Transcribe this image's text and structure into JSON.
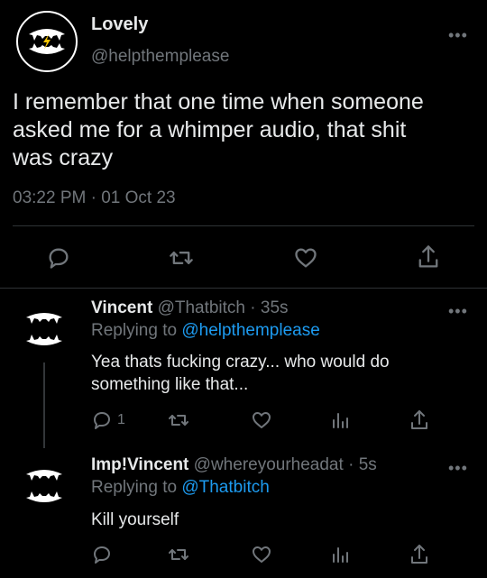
{
  "main_tweet": {
    "display_name": "Lovely",
    "handle": "@helpthemplease",
    "text_lines": [
      "I remember that one time when someone",
      "asked me for a whimper audio, that shit",
      "was crazy"
    ],
    "timestamp": "03:22 PM · 01 Oct 23"
  },
  "replies": [
    {
      "display_name": "Vincent",
      "handle": "@Thatbitch",
      "sep": "·",
      "time": "35s",
      "replying_prefix": "Replying to ",
      "replying_to": "@helpthemplease",
      "text_lines": [
        "Yea thats fucking crazy... who would do",
        "something like that..."
      ],
      "reply_count": "1"
    },
    {
      "display_name": "Imp!Vincent",
      "handle": "@whereyourheadat",
      "sep": "·",
      "time": "5s",
      "replying_prefix": "Replying to ",
      "replying_to": "@Thatbitch",
      "text_lines": [
        "Kill yourself"
      ],
      "reply_count": ""
    }
  ],
  "more_glyph": "•••",
  "colors": {
    "background": "#000000",
    "text": "#e7e9ea",
    "muted": "#71767b",
    "link": "#1d9bf0",
    "divider": "#2f3336"
  },
  "icons": [
    "reply-icon",
    "retweet-icon",
    "like-icon",
    "share-icon",
    "views-icon",
    "more-icon"
  ]
}
